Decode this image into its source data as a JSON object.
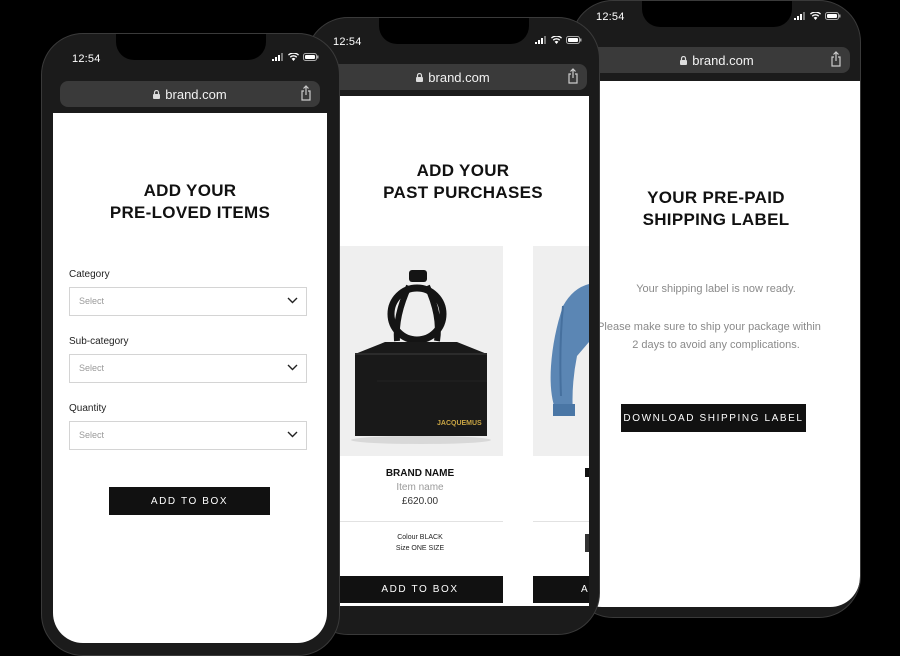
{
  "phones": [
    {
      "time": "12:54",
      "url": "brand.com",
      "title_line1": "ADD YOUR",
      "title_line2": "PRE-LOVED ITEMS",
      "fields": [
        {
          "label": "Category",
          "placeholder": "Select"
        },
        {
          "label": "Sub-category",
          "placeholder": "Select"
        },
        {
          "label": "Quantity",
          "placeholder": "Select"
        }
      ],
      "button": "ADD TO BOX"
    },
    {
      "time": "12:54",
      "url": "brand.com",
      "title_line1": "ADD YOUR",
      "title_line2": "PAST PURCHASES",
      "product": {
        "image_logo": "JACQUEMUS",
        "brand": "BRAND NAME",
        "name": "Item name",
        "price": "£620.00",
        "colour": "Colour BLACK",
        "size": "Size ONE SIZE"
      },
      "button": "ADD TO BOX",
      "next_button_partial": "A"
    },
    {
      "time": "12:54",
      "url": "brand.com",
      "title_line1": "YOUR PRE-PAID",
      "title_line2": "SHIPPING LABEL",
      "message": "Your shipping label is now ready.",
      "instructions_line1": "Please make sure to ship your package within",
      "instructions_line2": "2 days to avoid any complications.",
      "button": "DOWNLOAD SHIPPING LABEL"
    }
  ],
  "icons": {
    "lock": "lock-icon",
    "share": "share-icon",
    "chevron": "chevron-down-icon",
    "signal": "signal-icon",
    "wifi": "wifi-icon",
    "battery": "battery-icon"
  },
  "colors": {
    "background": "#000000",
    "phone_frame": "#1b1b1b",
    "urlbar": "#3a3a3a",
    "button": "#111111",
    "denim": "#5b86b4"
  }
}
